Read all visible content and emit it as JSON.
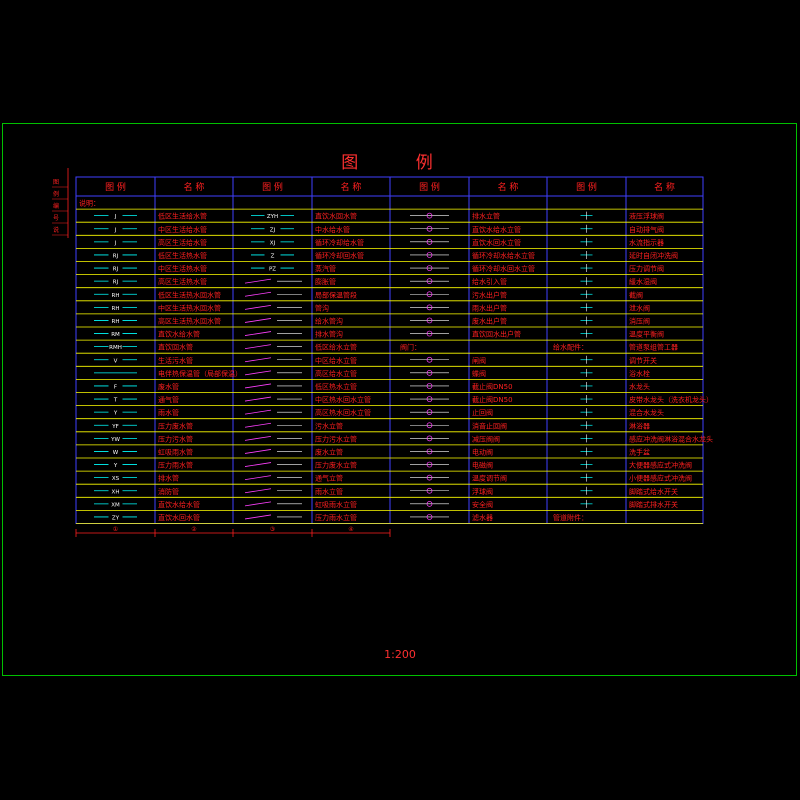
{
  "title": "图  例",
  "scale": "1:200",
  "header": [
    "图 例",
    "名 称",
    "图 例",
    "名 称",
    "图 例",
    "名 称",
    "图 例",
    "名 称"
  ],
  "colors": {
    "background": "#000000",
    "frame": "#00c000",
    "grid": "#4040ff",
    "row_line": "#ffff00",
    "text_red": "#ff2020",
    "symbol_cyan": "#00ffff",
    "symbol_white": "#ffffff",
    "symbol_magenta": "#ff40ff"
  },
  "rows": [
    [
      "说明：",
      "",
      "",
      "",
      "",
      "",
      "",
      ""
    ],
    [
      "J",
      "低区生活给水管",
      "ZYH",
      "直饮水回水管",
      "",
      "排水立管",
      "",
      "液压浮球阀"
    ],
    [
      "J",
      "中区生活给水管",
      "ZJ",
      "中水给水管",
      "",
      "直饮水给水立管",
      "",
      "自动排气阀"
    ],
    [
      "J",
      "高区生活给水管",
      "XJ",
      "循环冷却给水管",
      "",
      "直饮水回水立管",
      "",
      "水流指示器"
    ],
    [
      "RJ",
      "低区生活热水管",
      "Z",
      "循环冷却回水管",
      "",
      "循环冷却水给水立管",
      "",
      "延时自闭冲洗阀"
    ],
    [
      "RJ",
      "中区生活热水管",
      "PZ",
      "蒸汽管",
      "",
      "循环冷却水回水立管",
      "",
      "压力调节阀"
    ],
    [
      "RJ",
      "高区生活热水管",
      "",
      "膨胀管",
      "",
      "给水引入管",
      "",
      "緩水湿阀"
    ],
    [
      "RH",
      "低区生活热水回水管",
      "",
      "局部保温管段",
      "",
      "污水出户管",
      "",
      "截阀"
    ],
    [
      "RH",
      "中区生活热水回水管",
      "",
      "管沟",
      "",
      "雨水出户管",
      "",
      "泄水阀"
    ],
    [
      "RH",
      "高区生活热水回水管",
      "",
      "给水管沟",
      "",
      "废水出户管",
      "",
      "消压阀"
    ],
    [
      "RM",
      "直饮水给水管",
      "",
      "排水管沟",
      "",
      "直饮回水出户管",
      "",
      "温度平衡阀"
    ],
    [
      "RMH",
      "直饮回水管",
      "",
      "低区给水立管",
      "阀门：",
      "",
      "给水配件：",
      "管道泵组管工器"
    ],
    [
      "V",
      "生活污水管",
      "",
      "中区给水立管",
      "",
      "闸阀",
      "",
      "调节开关"
    ],
    [
      "",
      "电伴热保温管（局部保温）",
      "",
      "高区给水立管",
      "",
      "蝶阀",
      "",
      "浴水栓"
    ],
    [
      "F",
      "废水管",
      "",
      "低区热水立管",
      "",
      "截止阀DN50",
      "",
      "水龙头"
    ],
    [
      "T",
      "通气管",
      "",
      "中区热水回水立管",
      "",
      "截止阀DN50",
      "",
      "皮带水龙头（洗衣机龙头）"
    ],
    [
      "Y",
      "雨水管",
      "",
      "高区热水回水立管",
      "",
      "止回阀",
      "",
      "混合水龙头"
    ],
    [
      "YF",
      "压力废水管",
      "",
      "污水立管",
      "",
      "消音止回阀",
      "",
      "淋浴器"
    ],
    [
      "YW",
      "压力污水管",
      "",
      "压力污水立管",
      "",
      "减压阀阀",
      "",
      "感应冲洗阀淋浴混合水龙头"
    ],
    [
      "W",
      "虹吸雨水管",
      "",
      "废水立管",
      "",
      "电动阀",
      "",
      "洗手盆"
    ],
    [
      "Y",
      "压力雨水管",
      "",
      "压力废水立管",
      "",
      "电磁阀",
      "",
      "大便器感应式冲洗阀"
    ],
    [
      "XS",
      "排水管",
      "",
      "通气立管",
      "",
      "温度调节阀",
      "",
      "小便器感应式冲洗阀"
    ],
    [
      "XH",
      "消防管",
      "",
      "雨水立管",
      "",
      "浮球阀",
      "",
      "脚踏式给水开关"
    ],
    [
      "XM",
      "直饮水给水管",
      "",
      "虹吸雨水立管",
      "",
      "安全阀",
      "",
      "脚踏式排水开关"
    ],
    [
      "ZY",
      "直饮水回水管",
      "",
      "压力雨水立管",
      "",
      "滤水器",
      "管道附件：",
      ""
    ]
  ],
  "sidebar_labels": [
    "图",
    "例",
    "编",
    "号",
    "说"
  ],
  "dim_marks": [
    "①",
    "②",
    "③",
    "④"
  ]
}
